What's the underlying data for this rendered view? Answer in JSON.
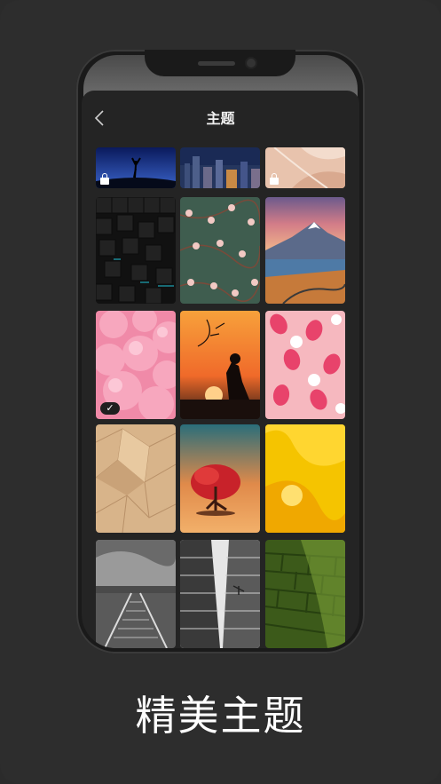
{
  "header": {
    "title": "主题",
    "back_icon": "chevron-left-icon"
  },
  "themes": [
    {
      "name": "night-silhouette",
      "locked": true,
      "selected": false
    },
    {
      "name": "city-night",
      "locked": false,
      "selected": false
    },
    {
      "name": "peach-abstract",
      "locked": true,
      "selected": false
    },
    {
      "name": "dark-cubes",
      "locked": false,
      "selected": false
    },
    {
      "name": "cherry-blossom-pattern",
      "locked": false,
      "selected": false
    },
    {
      "name": "mountain-lake",
      "locked": false,
      "selected": false
    },
    {
      "name": "pink-spheres",
      "locked": false,
      "selected": true
    },
    {
      "name": "sunset-silhouette",
      "locked": false,
      "selected": false
    },
    {
      "name": "dragon-fruit-pattern",
      "locked": false,
      "selected": false
    },
    {
      "name": "wooden-polygons",
      "locked": false,
      "selected": false
    },
    {
      "name": "red-tree-sunset",
      "locked": false,
      "selected": false
    },
    {
      "name": "yellow-gradient",
      "locked": false,
      "selected": false
    },
    {
      "name": "railway-bw",
      "locked": false,
      "selected": false
    },
    {
      "name": "skyscraper-plane",
      "locked": false,
      "selected": false
    },
    {
      "name": "green-moss-wall",
      "locked": false,
      "selected": false
    }
  ],
  "icons": {
    "selected": "✓"
  },
  "caption": "精美主题",
  "colors": {
    "background": "#2d2d2d",
    "screen": "#242424",
    "title": "#f0f0f0"
  }
}
